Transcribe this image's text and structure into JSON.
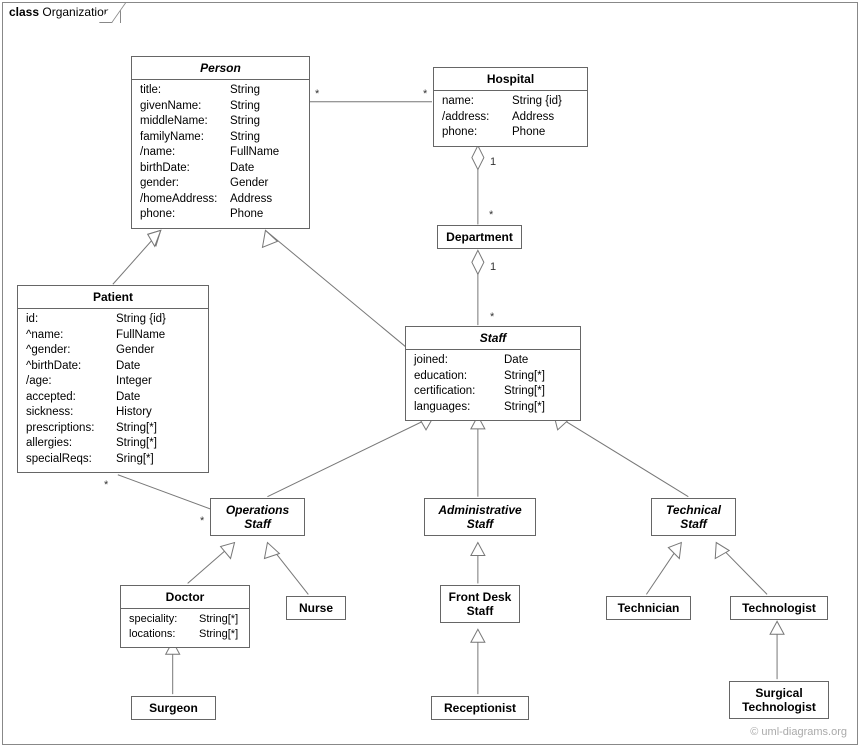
{
  "frame": {
    "label_prefix": "class",
    "label_name": "Organization"
  },
  "watermark": "© uml-diagrams.org",
  "classes": {
    "person": {
      "name": "Person",
      "attrs": [
        {
          "k": "title:",
          "v": "String"
        },
        {
          "k": "givenName:",
          "v": "String"
        },
        {
          "k": "middleName:",
          "v": "String"
        },
        {
          "k": "familyName:",
          "v": "String"
        },
        {
          "k": "/name:",
          "v": "FullName"
        },
        {
          "k": "birthDate:",
          "v": "Date"
        },
        {
          "k": "gender:",
          "v": "Gender"
        },
        {
          "k": "/homeAddress:",
          "v": "Address"
        },
        {
          "k": "phone:",
          "v": "Phone"
        }
      ]
    },
    "hospital": {
      "name": "Hospital",
      "attrs": [
        {
          "k": "name:",
          "v": "String {id}"
        },
        {
          "k": "/address:",
          "v": "Address"
        },
        {
          "k": "phone:",
          "v": "Phone"
        }
      ]
    },
    "department": {
      "name": "Department"
    },
    "patient": {
      "name": "Patient",
      "attrs": [
        {
          "k": "id:",
          "v": "String {id}"
        },
        {
          "k": "^name:",
          "v": "FullName"
        },
        {
          "k": "^gender:",
          "v": "Gender"
        },
        {
          "k": "^birthDate:",
          "v": "Date"
        },
        {
          "k": "/age:",
          "v": "Integer"
        },
        {
          "k": "accepted:",
          "v": "Date"
        },
        {
          "k": "sickness:",
          "v": "History"
        },
        {
          "k": "prescriptions:",
          "v": "String[*]"
        },
        {
          "k": "allergies:",
          "v": "String[*]"
        },
        {
          "k": "specialReqs:",
          "v": "Sring[*]"
        }
      ]
    },
    "staff": {
      "name": "Staff",
      "attrs": [
        {
          "k": "joined:",
          "v": "Date"
        },
        {
          "k": "education:",
          "v": "String[*]"
        },
        {
          "k": "certification:",
          "v": "String[*]"
        },
        {
          "k": "languages:",
          "v": "String[*]"
        }
      ]
    },
    "opsStaff": {
      "name1": "Operations",
      "name2": "Staff"
    },
    "adminStaff": {
      "name1": "Administrative",
      "name2": "Staff"
    },
    "techStaff": {
      "name1": "Technical",
      "name2": "Staff"
    },
    "doctor": {
      "name": "Doctor",
      "attrs": [
        {
          "k": "speciality:",
          "v": "String[*]"
        },
        {
          "k": "locations:",
          "v": "String[*]"
        }
      ]
    },
    "nurse": {
      "name": "Nurse"
    },
    "frontDesk": {
      "name1": "Front Desk",
      "name2": "Staff"
    },
    "technician": {
      "name": "Technician"
    },
    "technologist": {
      "name": "Technologist"
    },
    "surgeon": {
      "name": "Surgeon"
    },
    "receptionist": {
      "name": "Receptionist"
    },
    "surgTech": {
      "name1": "Surgical",
      "name2": "Technologist"
    }
  },
  "mult": {
    "person_hospital_left": "*",
    "person_hospital_right": "*",
    "hospital_dept_top": "1",
    "hospital_dept_bottom": "*",
    "dept_staff_top": "1",
    "dept_staff_bottom": "*",
    "patient_ops_left": "*",
    "patient_ops_right": "*"
  }
}
